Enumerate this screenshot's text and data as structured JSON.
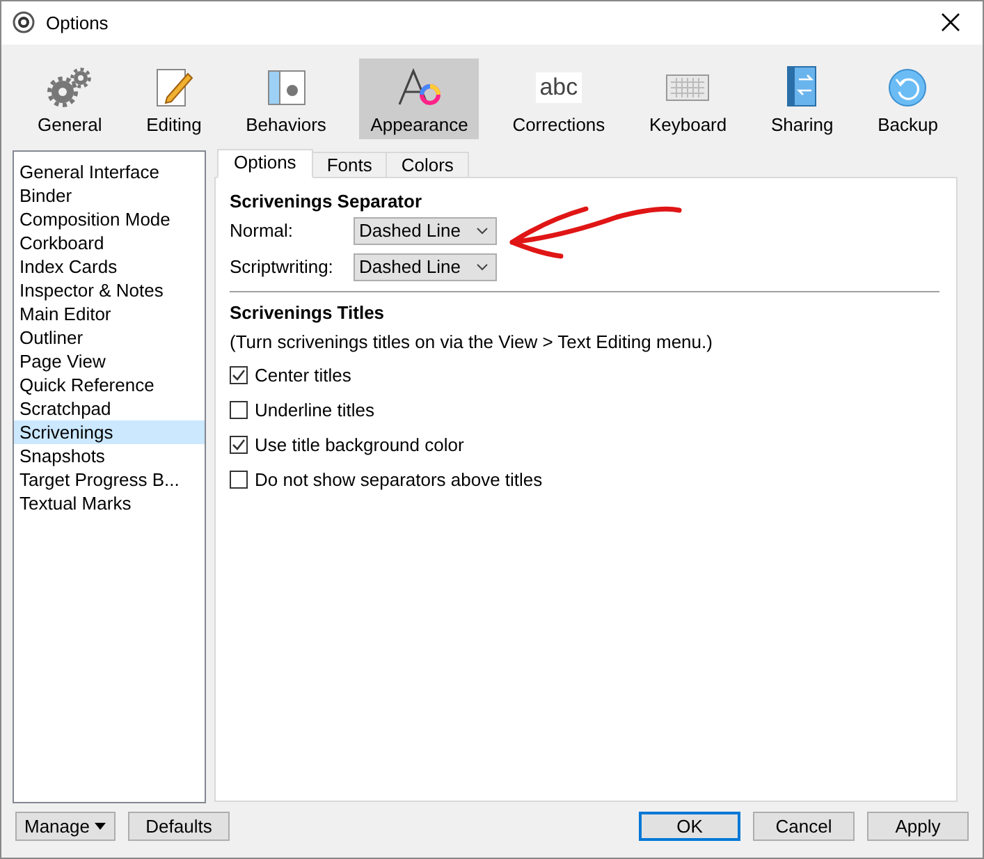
{
  "window": {
    "title": "Options"
  },
  "toolbar": [
    {
      "label": "General",
      "kind": "gears",
      "selected": false
    },
    {
      "label": "Editing",
      "kind": "notepad",
      "selected": false
    },
    {
      "label": "Behaviors",
      "kind": "window",
      "selected": false
    },
    {
      "label": "Appearance",
      "kind": "font",
      "selected": true
    },
    {
      "label": "Corrections",
      "kind": "abc",
      "icon_text": "abc",
      "selected": false
    },
    {
      "label": "Keyboard",
      "kind": "keyboard",
      "selected": false
    },
    {
      "label": "Sharing",
      "kind": "sharing",
      "selected": false
    },
    {
      "label": "Backup",
      "kind": "backup",
      "selected": false
    }
  ],
  "sidebar": {
    "items": [
      {
        "label": "General Interface",
        "selected": false
      },
      {
        "label": "Binder",
        "selected": false
      },
      {
        "label": "Composition Mode",
        "selected": false
      },
      {
        "label": "Corkboard",
        "selected": false
      },
      {
        "label": "Index Cards",
        "selected": false
      },
      {
        "label": "Inspector & Notes",
        "selected": false
      },
      {
        "label": "Main Editor",
        "selected": false
      },
      {
        "label": "Outliner",
        "selected": false
      },
      {
        "label": "Page View",
        "selected": false
      },
      {
        "label": "Quick Reference",
        "selected": false
      },
      {
        "label": "Scratchpad",
        "selected": false
      },
      {
        "label": "Scrivenings",
        "selected": true
      },
      {
        "label": "Snapshots",
        "selected": false
      },
      {
        "label": "Target Progress B...",
        "selected": false
      },
      {
        "label": "Textual Marks",
        "selected": false
      }
    ]
  },
  "tabs": [
    {
      "label": "Options",
      "selected": true
    },
    {
      "label": "Fonts",
      "selected": false
    },
    {
      "label": "Colors",
      "selected": false
    }
  ],
  "separator_section": {
    "heading": "Scrivenings Separator",
    "fields": [
      {
        "label": "Normal:",
        "value": "Dashed Line"
      },
      {
        "label": "Scriptwriting:",
        "value": "Dashed Line"
      }
    ]
  },
  "titles_section": {
    "heading": "Scrivenings Titles",
    "note": "(Turn scrivenings titles on via the View > Text Editing menu.)",
    "checkboxes": [
      {
        "label": "Center titles",
        "checked": true
      },
      {
        "label": "Underline titles",
        "checked": false
      },
      {
        "label": "Use title background color",
        "checked": true
      },
      {
        "label": "Do not show separators above titles",
        "checked": false
      }
    ]
  },
  "buttons": [
    {
      "label": "Manage",
      "kind": "menu",
      "default": false
    },
    {
      "label": "Defaults",
      "kind": "plain",
      "default": false
    },
    {
      "label": "OK",
      "kind": "plain",
      "default": true
    },
    {
      "label": "Cancel",
      "kind": "plain",
      "default": false
    },
    {
      "label": "Apply",
      "kind": "plain",
      "default": false
    }
  ]
}
